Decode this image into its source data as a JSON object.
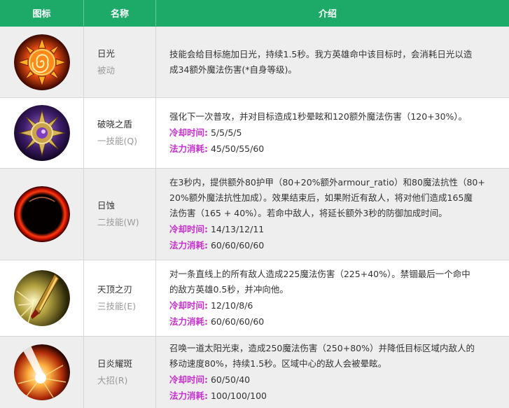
{
  "header": {
    "icon": "图标",
    "name": "名称",
    "desc": "介绍"
  },
  "skills": [
    {
      "icon": "sun-swirl-icon",
      "name": "日光",
      "type": "被动",
      "desc": [
        "技能会给目标施加日光，持续1.5秒。我方英雄命中该目标时，会消耗日光以造",
        "成34额外魔法伤害(*自身等级)。"
      ],
      "cooldown_label": "",
      "cooldown": "",
      "mana_label": "",
      "mana": ""
    },
    {
      "icon": "dawn-shield-icon",
      "name": "破晓之盾",
      "type": "一技能(Q)",
      "desc": [
        "强化下一次普攻，并对目标造成1秒晕眩和120额外魔法伤害（120+30%）。"
      ],
      "cooldown_label": "冷却时间:",
      "cooldown": "5/5/5/5",
      "mana_label": "法力消耗:",
      "mana": "45/50/55/60"
    },
    {
      "icon": "eclipse-icon",
      "name": "日蚀",
      "type": "二技能(W)",
      "desc": [
        "在3秒内，提供额外80护甲（80+20%额外armour_ratio）和80魔法抗性（80+",
        "20%额外魔法抗性加成）。效果结束后，如果附近有敌人，将对他们造成165魔",
        "法伤害（165 + 40%）。若命中敌人，将延长额外3秒的防御加成时间。"
      ],
      "cooldown_label": "冷却时间:",
      "cooldown": "14/13/12/11",
      "mana_label": "法力消耗:",
      "mana": "60/60/60/60"
    },
    {
      "icon": "zenith-blade-icon",
      "name": "天顶之刃",
      "type": "三技能(E)",
      "desc": [
        "对一条直线上的所有敌人造成225魔法伤害（225+40%）。禁锢最后一个命中",
        "的敌方英雄0.5秒，并冲向他。"
      ],
      "cooldown_label": "冷却时间:",
      "cooldown": "12/10/8/6",
      "mana_label": "法力消耗:",
      "mana": "60/60/60/60"
    },
    {
      "icon": "solar-flare-icon",
      "name": "日炎耀斑",
      "type": "大招(R)",
      "desc": [
        "召唤一道太阳光束，造成250魔法伤害（250+80%）并降低目标区域内敌人的",
        "移动速度80%，持续1.5秒。区域中心的敌人会被晕眩。"
      ],
      "cooldown_label": "冷却时间:",
      "cooldown": "60/50/40",
      "mana_label": "法力消耗:",
      "mana": "100/100/100"
    }
  ],
  "colors": {
    "header_bg": "#1da968",
    "label_magenta": "#c82fd0"
  }
}
